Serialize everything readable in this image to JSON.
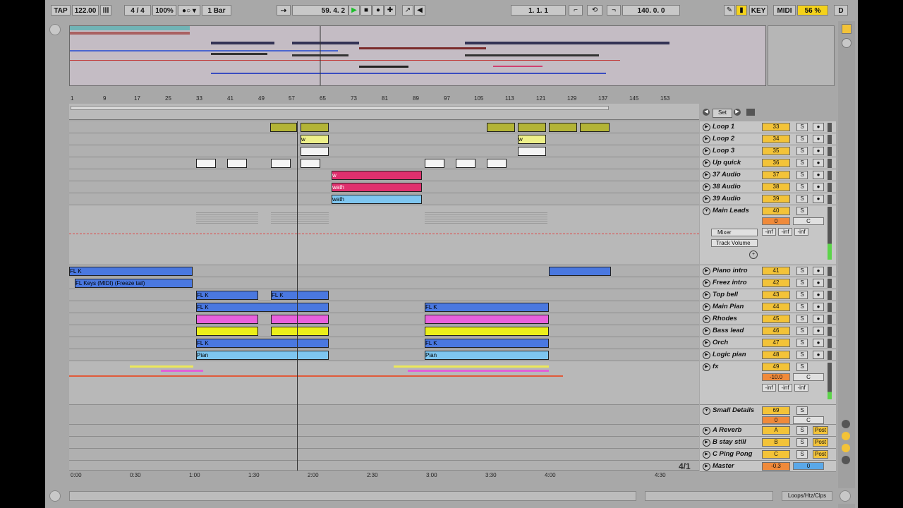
{
  "transport": {
    "tap": "TAP",
    "tempo": "122.00",
    "signature_num": "4",
    "signature_den": "4",
    "zoom": "100%",
    "quantize": "1 Bar",
    "position": "59.  4.  2",
    "loop_start": "1.  1.  1",
    "loop_length": "140.  0.  0",
    "key_label": "KEY",
    "midi_label": "MIDI",
    "cpu": "56 %",
    "d_label": "D"
  },
  "ruler": {
    "bars": [
      "1",
      "9",
      "17",
      "25",
      "33",
      "41",
      "49",
      "57",
      "65",
      "73",
      "81",
      "89",
      "97",
      "105",
      "113",
      "121",
      "129",
      "137",
      "145",
      "153"
    ]
  },
  "timebar": {
    "times": [
      "0:00",
      "0:30",
      "1:00",
      "1:30",
      "2:00",
      "2:30",
      "3:00",
      "3:30",
      "4:00",
      "4:30"
    ],
    "signature": "4/1"
  },
  "scene_nav": {
    "set_label": "Set"
  },
  "tracks": [
    {
      "name": "Loop 1",
      "num": "33",
      "s": "S"
    },
    {
      "name": "Loop 2",
      "num": "34",
      "s": "S"
    },
    {
      "name": "Loop 3",
      "num": "35",
      "s": "S"
    },
    {
      "name": "Up quick",
      "num": "36",
      "s": "S"
    },
    {
      "name": "37 Audio",
      "num": "37",
      "s": "S"
    },
    {
      "name": "38 Audio",
      "num": "38",
      "s": "S"
    },
    {
      "name": "39 Audio",
      "num": "39",
      "s": "S"
    },
    {
      "name": "Main Leads",
      "num": "40",
      "s": "S",
      "vol": "0",
      "pan": "C",
      "send1": "-inf",
      "send2": "-inf",
      "send3": "-inf",
      "mixer": "Mixer",
      "automation": "Track Volume"
    },
    {
      "name": "Piano intro",
      "num": "41",
      "s": "S"
    },
    {
      "name": "Freez intro",
      "num": "42",
      "s": "S"
    },
    {
      "name": "Top bell",
      "num": "43",
      "s": "S"
    },
    {
      "name": "Main Pian",
      "num": "44",
      "s": "S"
    },
    {
      "name": "Rhodes",
      "num": "45",
      "s": "S"
    },
    {
      "name": "Bass lead",
      "num": "46",
      "s": "S"
    },
    {
      "name": "Orch",
      "num": "47",
      "s": "S"
    },
    {
      "name": "Logic pian",
      "num": "48",
      "s": "S"
    },
    {
      "name": "fx",
      "num": "49",
      "s": "S",
      "vol": "-10.0",
      "pan": "C",
      "send1": "-inf",
      "send2": "-inf",
      "send3": "-inf"
    },
    {
      "name": "Small Details",
      "num": "69",
      "s": "S",
      "vol": "0",
      "pan": "C"
    }
  ],
  "returns": [
    {
      "name": "A Reverb",
      "letter": "A",
      "s": "S",
      "post": "Post"
    },
    {
      "name": "B stay still",
      "letter": "B",
      "s": "S",
      "post": "Post"
    },
    {
      "name": "C Ping Pong",
      "letter": "C",
      "s": "S",
      "post": "Post"
    }
  ],
  "master": {
    "name": "Master",
    "vol": "-0.3",
    "pan": "0"
  },
  "clips": {
    "fl_keys_freeze": "FL Keys (MIDI) (Freeze tail)",
    "fl": "FL K",
    "pian": "Pian",
    "w": "w",
    "wath": "wath"
  },
  "statusbar": {
    "right_label": "Loops/Htz/Clps"
  }
}
